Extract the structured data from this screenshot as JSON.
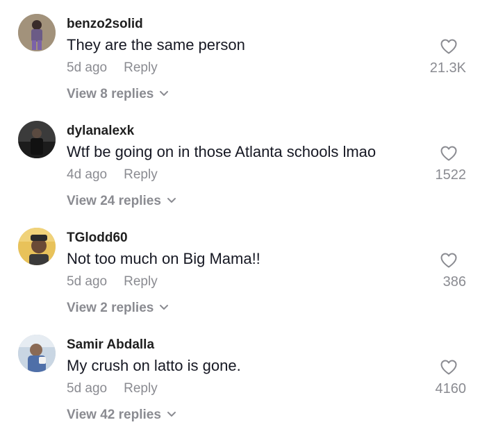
{
  "comments": [
    {
      "username": "benzo2solid",
      "text": "They are the same person",
      "time": "5d ago",
      "reply_label": "Reply",
      "view_replies": "View 8 replies",
      "likes": "21.3K",
      "avatar_color": "#7a6d8f"
    },
    {
      "username": "dylanalexk",
      "text": "Wtf be going on in those Atlanta schools lmao",
      "time": "4d ago",
      "reply_label": "Reply",
      "view_replies": "View 24 replies",
      "likes": "1522",
      "avatar_color": "#2a2a2a"
    },
    {
      "username": "TGlodd60",
      "text": "Not too much on Big Mama!!",
      "time": "5d ago",
      "reply_label": "Reply",
      "view_replies": "View 2 replies",
      "likes": "386",
      "avatar_color": "#e0b64f"
    },
    {
      "username": "Samir Abdalla",
      "text": "My crush on latto is gone.",
      "time": "5d ago",
      "reply_label": "Reply",
      "view_replies": "View 42 replies",
      "likes": "4160",
      "avatar_color": "#9fb4cc"
    }
  ],
  "icons": {
    "like": "heart-outline-icon",
    "expand": "chevron-down-icon"
  },
  "colors": {
    "secondary_text": "#8a8b91",
    "primary_text": "#161823"
  }
}
